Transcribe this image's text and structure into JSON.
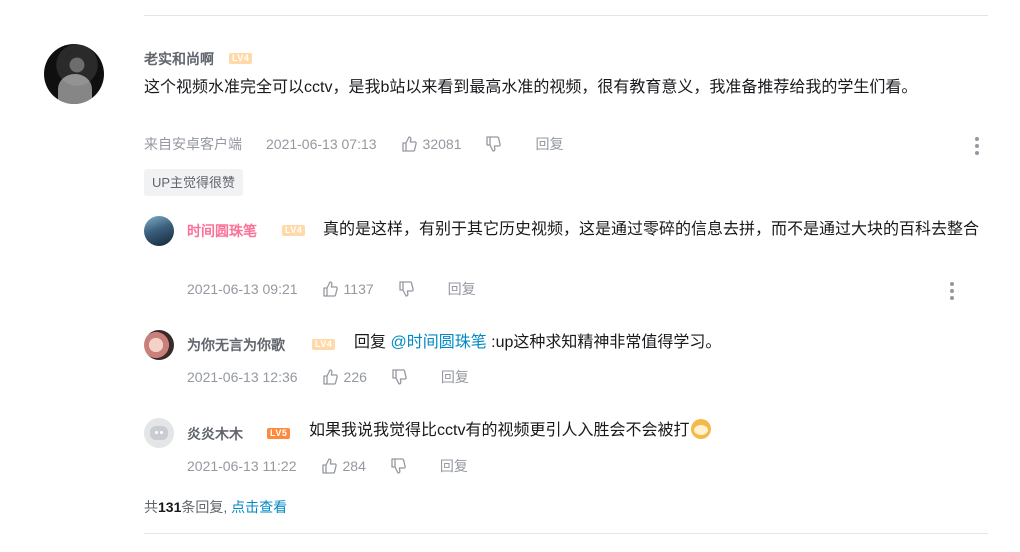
{
  "main_comment": {
    "username": "老实和尚啊",
    "level": "LV4",
    "text": "这个视频水准完全可以cctv，是我b站以来看到最高水准的视频，很有教育意义，我准备推荐给我的学生们看。",
    "source": "来自安卓客户端",
    "timestamp": "2021-06-13 07:13",
    "likes": "32081",
    "reply_label": "回复",
    "up_badge": "UP主觉得很赞"
  },
  "replies": [
    {
      "username": "时间圆珠笔",
      "level": "LV4",
      "text": "真的是这样，有别于其它历史视频，这是通过零碎的信息去拼，而不是通过大块的百科去整合",
      "timestamp": "2021-06-13 09:21",
      "likes": "1137",
      "reply_label": "回复"
    },
    {
      "username": "为你无言为你歌",
      "level": "LV4",
      "text_prefix": "回复 ",
      "mention": "@时间圆珠笔",
      "text": " :up这种求知精神非常值得学习。",
      "timestamp": "2021-06-13 12:36",
      "likes": "226",
      "reply_label": "回复"
    },
    {
      "username": "炎炎木木",
      "level": "LV5",
      "text": "如果我说我觉得比cctv有的视频更引人入胜会不会被打",
      "timestamp": "2021-06-13 11:22",
      "likes": "284",
      "reply_label": "回复"
    }
  ],
  "footer": {
    "prefix": "共",
    "count": "131",
    "suffix": "条回复,",
    "link": "点击查看"
  },
  "colors": {
    "accent_link": "#008ac5",
    "username_vip": "#fb7299",
    "meta_gray": "#9499a0"
  },
  "icons": {
    "like": "thumb-up-icon",
    "dislike": "thumb-down-icon",
    "more": "more-vertical-icon"
  }
}
